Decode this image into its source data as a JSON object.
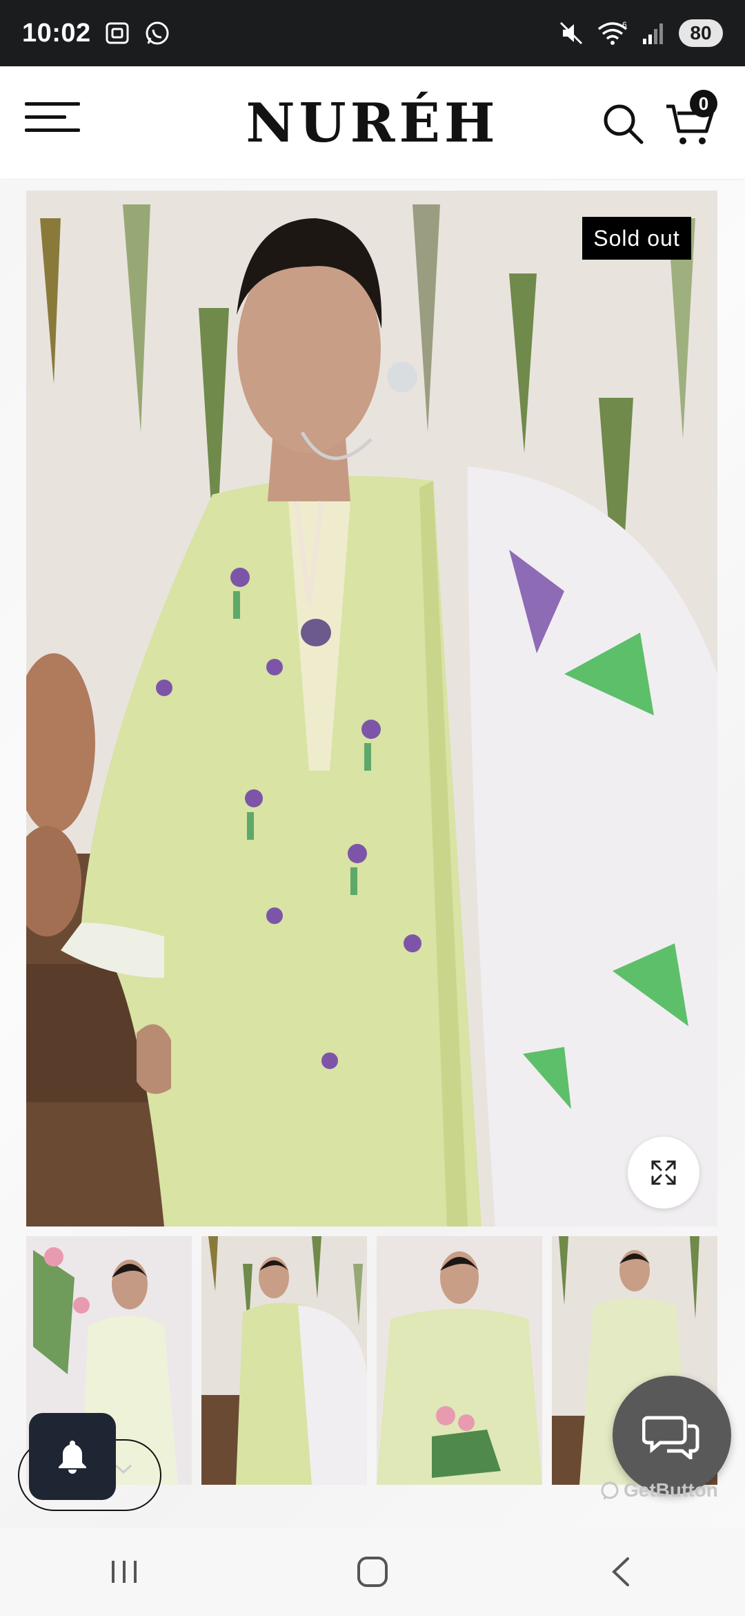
{
  "status_bar": {
    "time": "10:02",
    "battery": "80",
    "icons": [
      "screenshot-icon",
      "whatsapp-icon",
      "mute-icon",
      "wifi-icon",
      "signal-icon"
    ]
  },
  "header": {
    "brand": "NURÉH",
    "cart_count": "0",
    "icons": [
      "menu-icon",
      "search-icon",
      "cart-icon"
    ]
  },
  "product": {
    "badge": "Sold out",
    "main_image": "model-in-light-green-embroidered-lawn-suit",
    "thumbnails": [
      "thumb-front-with-flowers",
      "thumb-full-length",
      "thumb-seated-with-flowers",
      "thumb-standing-full"
    ]
  },
  "widgets": {
    "chat_label": "GetButton",
    "chat_icon": "chat-bubbles-icon",
    "bell_icon": "bell-icon"
  },
  "colors": {
    "status_bar_bg": "#1b1c1e",
    "outfit_green": "#d9e4a6",
    "badge_bg": "#000000",
    "chat_bg": "#595959",
    "bell_bg": "#1f2633"
  }
}
